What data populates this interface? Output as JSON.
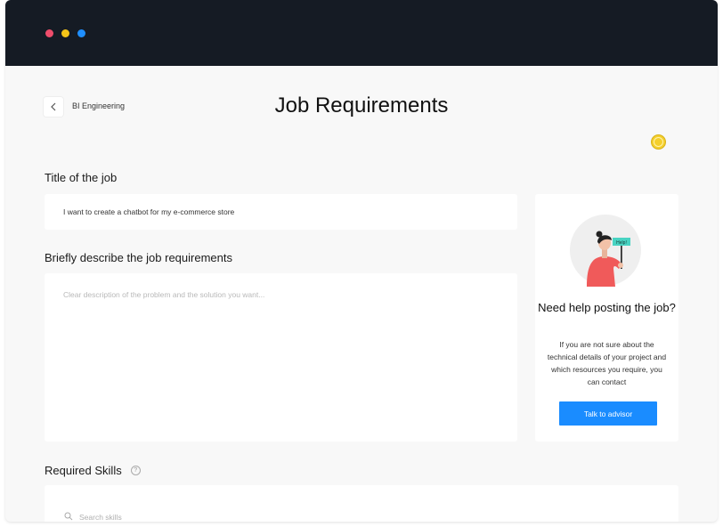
{
  "window": {
    "controls": [
      "close",
      "minimize",
      "zoom"
    ],
    "control_colors": [
      "#ee4d6b",
      "#f5c518",
      "#1f8fff"
    ]
  },
  "breadcrumb": {
    "label": "BI Engineering",
    "back_icon": "chevron-left-icon"
  },
  "page": {
    "title": "Job Requirements"
  },
  "form": {
    "job_title": {
      "label": "Title of the job",
      "value": "I want to create a chatbot for my e-commerce store"
    },
    "description": {
      "label": "Briefly describe the job requirements",
      "placeholder": "Clear description of the problem and the solution you want..."
    },
    "skills": {
      "label": "Required Skills",
      "help_icon": "question-circle-icon",
      "placeholder": "Search skills",
      "search_icon": "search-icon"
    }
  },
  "help_card": {
    "sign_text": "Help!",
    "title": "Need help posting the job?",
    "text": "If you are not sure about the technical details of your project and which resources you require, you can contact",
    "button_label": "Talk to advisor",
    "accent": "#1a8cff"
  }
}
